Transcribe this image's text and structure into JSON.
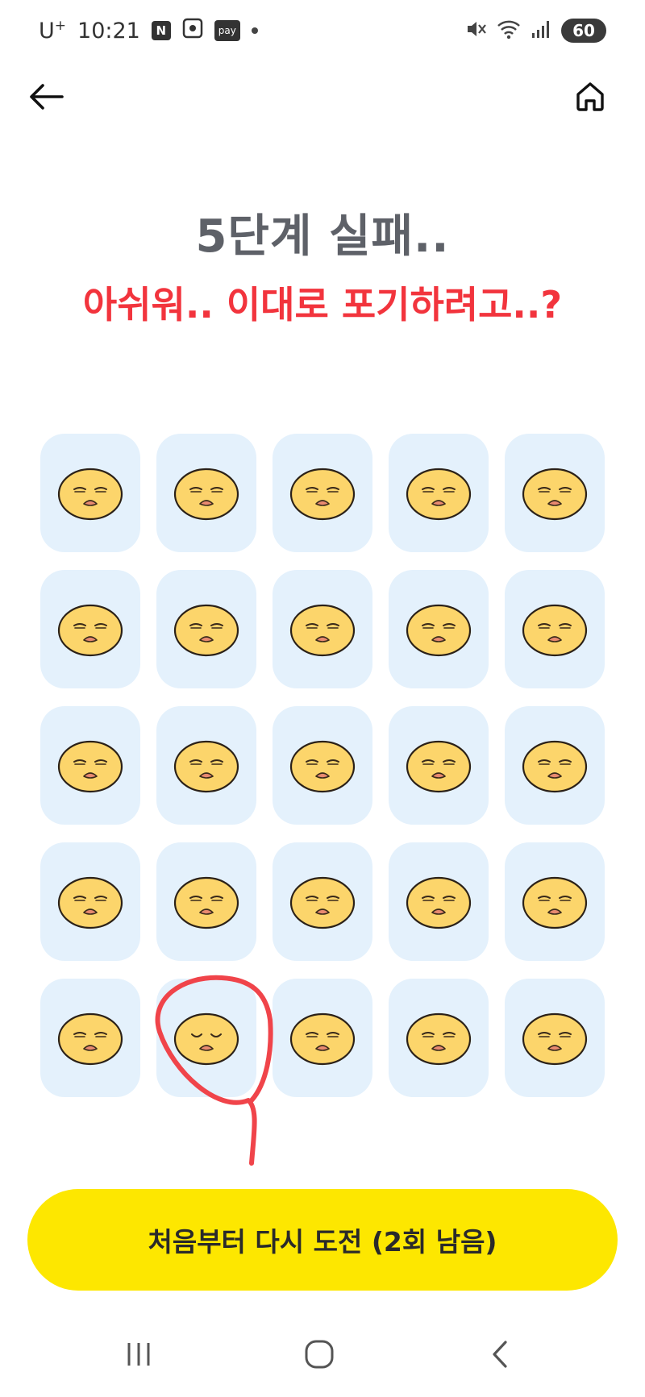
{
  "status_bar": {
    "carrier": "U",
    "carrier_sup": "+",
    "time": "10:21",
    "icon_n": "N",
    "icon_pay": "pay",
    "battery": "60",
    "icons": [
      "naver-icon",
      "screenshot-icon",
      "pay-icon",
      "dot-icon",
      "mute-icon",
      "wifi-icon",
      "signal-icon",
      "battery-icon"
    ]
  },
  "header": {
    "back_icon": "arrow-left-icon",
    "home_icon": "home-icon"
  },
  "title": "5단계 실패..",
  "subtitle": "아쉬워.. 이대로 포기하려고..?",
  "colors": {
    "title": "#5e6168",
    "subtitle": "#f2343d",
    "tile_bg": "#e4f1fc",
    "face": "#fcd56b",
    "button": "#fde700",
    "annotation": "#f0444a"
  },
  "grid": {
    "rows": 5,
    "columns": 5,
    "tile_icon": "sad-face-icon",
    "annotated_tile": {
      "row": 5,
      "column": 2
    }
  },
  "retry_button_label": "처음부터 다시 도전 (2회 남음)",
  "nav": {
    "icons": [
      "recents-icon",
      "home-circle-icon",
      "back-chevron-icon"
    ]
  }
}
